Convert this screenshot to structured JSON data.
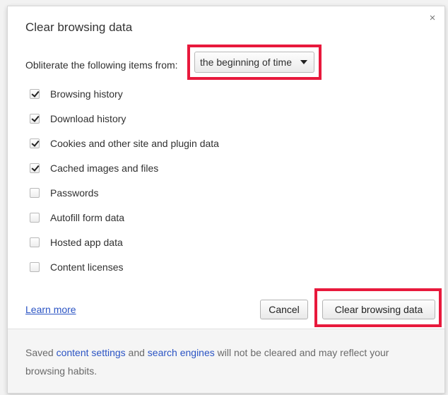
{
  "dialog": {
    "title": "Clear browsing data",
    "close_glyph": "×"
  },
  "timerange": {
    "label": "Obliterate the following items from:",
    "selected": "the beginning of time"
  },
  "items": [
    {
      "label": "Browsing history",
      "checked": true
    },
    {
      "label": "Download history",
      "checked": true
    },
    {
      "label": "Cookies and other site and plugin data",
      "checked": true
    },
    {
      "label": "Cached images and files",
      "checked": true
    },
    {
      "label": "Passwords",
      "checked": false
    },
    {
      "label": "Autofill form data",
      "checked": false
    },
    {
      "label": "Hosted app data",
      "checked": false
    },
    {
      "label": "Content licenses",
      "checked": false
    }
  ],
  "footer": {
    "learn_more": "Learn more",
    "cancel_label": "Cancel",
    "clear_label": "Clear browsing data"
  },
  "info": {
    "prefix": "Saved ",
    "content_settings": "content settings",
    "middle": " and ",
    "search_engines": "search engines",
    "suffix": " will not be cleared and may reflect your browsing habits."
  },
  "highlight_color": "#e8193c",
  "link_color": "#2b54c4"
}
